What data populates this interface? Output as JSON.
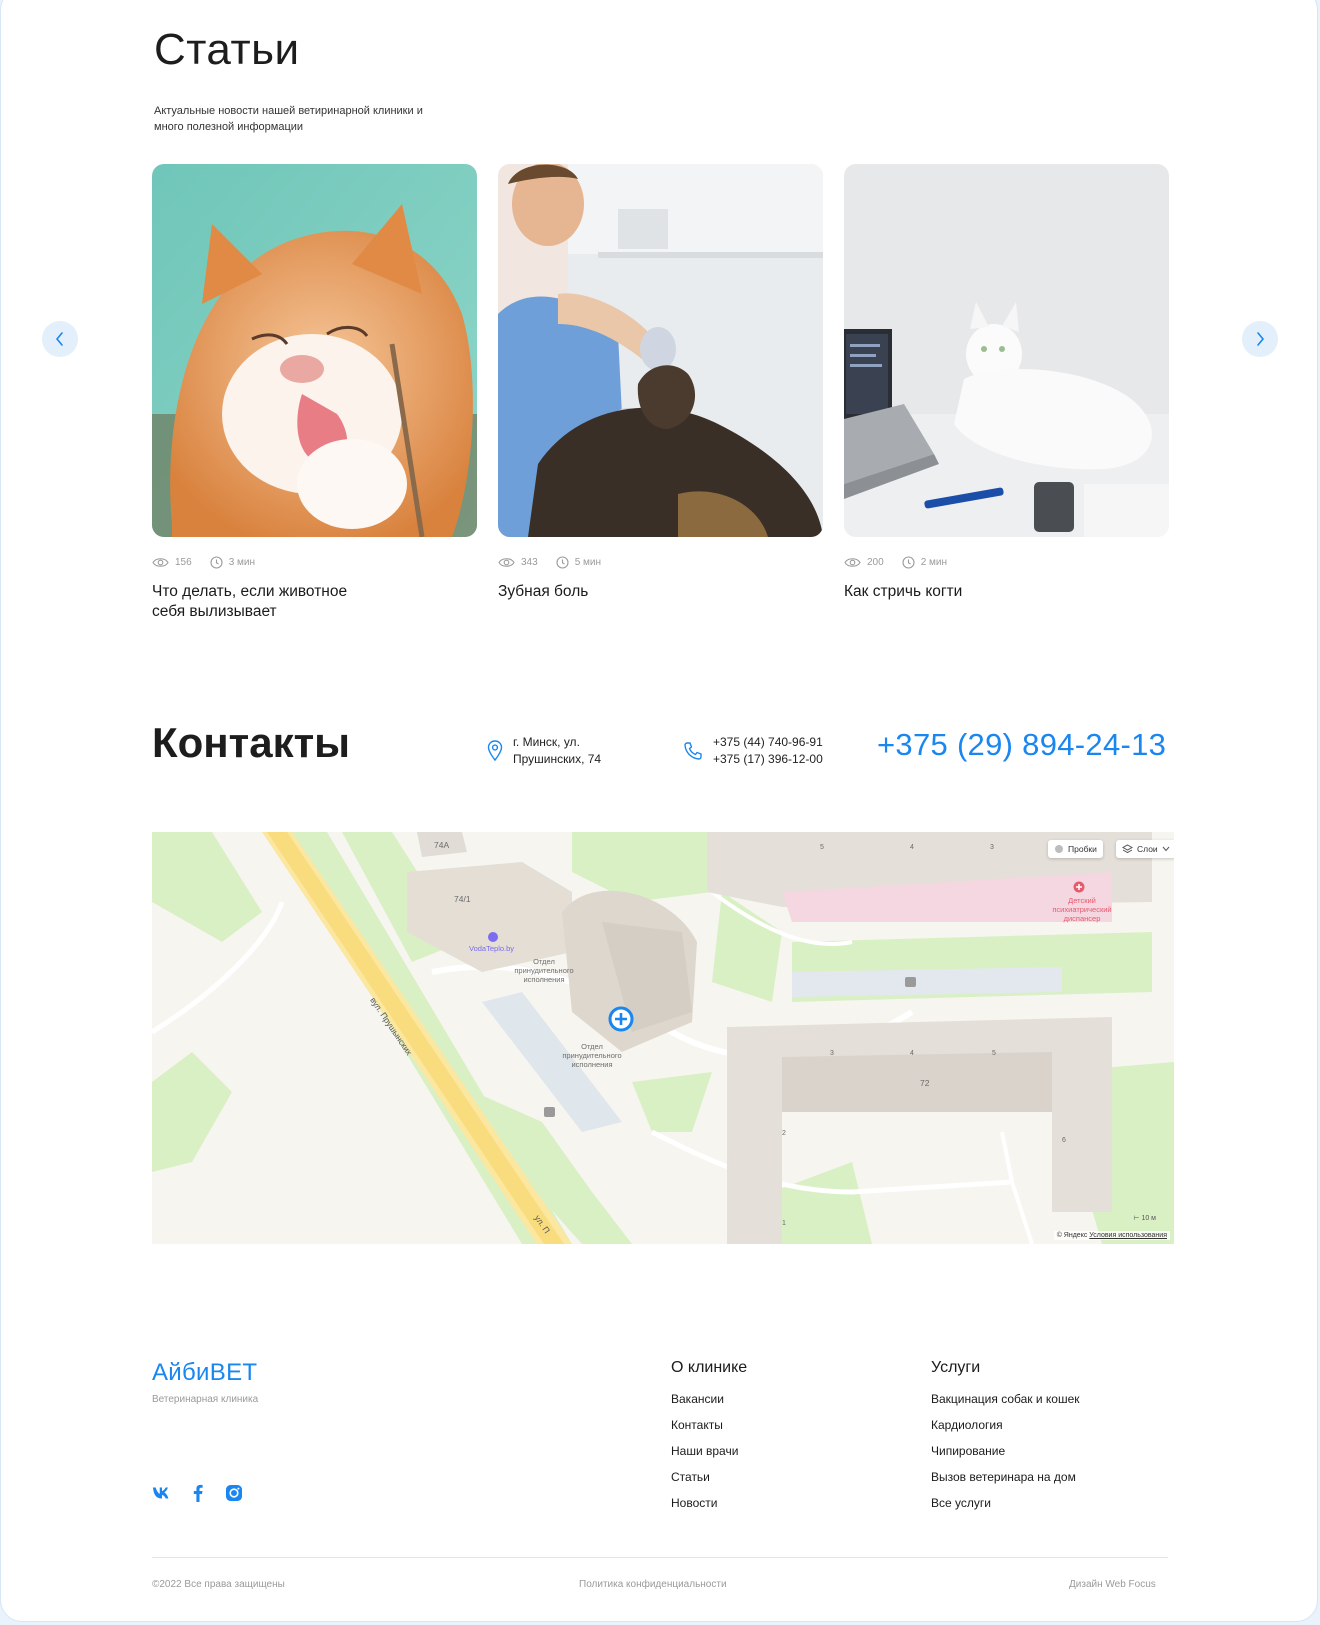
{
  "articles": {
    "title": "Статьи",
    "subtitle": "Актуальные новости нашей ветиринарной клиники и много полезной информации",
    "items": [
      {
        "views": "156",
        "time": "3 мин",
        "title": "Что делать, если животное себя вылизывает"
      },
      {
        "views": "343",
        "time": "5 мин",
        "title": "Зубная боль"
      },
      {
        "views": "200",
        "time": "2 мин",
        "title": "Как стричь когти"
      }
    ]
  },
  "contacts": {
    "title": "Контакты",
    "address_line1": "г. Минск, ул.",
    "address_line2": "Прушинских, 74",
    "phone1": "+375 (44) 740-96-91",
    "phone2": "+375 (17) 396-12-00",
    "main_phone": "+375 (29) 894-24-13"
  },
  "map": {
    "traffic_label": "Пробки",
    "layers_label": "Слои",
    "copyright": "© Яндекс",
    "terms": "Условия использования",
    "scale": "10 м",
    "street_label": "вул. Прушынских",
    "street_label2": "ул. П",
    "poi_vodateplo": "VodaTeplo.by",
    "poi_dept": "Отдел принудительного исполнения",
    "poi_dispensary": "Детский психиатрический диспансер",
    "buildings": [
      "74А",
      "74/1",
      "72"
    ],
    "entrances": [
      "5",
      "4",
      "3",
      "3",
      "4",
      "5",
      "2",
      "6",
      "1"
    ]
  },
  "footer": {
    "logo": "АйбиВЕТ",
    "logo_sub": "Ветеринарная клиника",
    "col1_title": "О клинике",
    "col1_links": [
      "Вакансии",
      "Контакты",
      "Наши врачи",
      "Статьи",
      "Новости"
    ],
    "col2_title": "Услуги",
    "col2_links": [
      "Вакцинация собак и кошек",
      "Кардиология",
      "Чипирование",
      "Вызов ветеринара на дом",
      "Все услуги"
    ],
    "copyright": "©2022 Все права защищены",
    "privacy": "Политика конфиденциальности",
    "design": "Дизайн Web Focus"
  },
  "colors": {
    "accent": "#1a86f0",
    "arrow_bg": "#e3effb"
  }
}
